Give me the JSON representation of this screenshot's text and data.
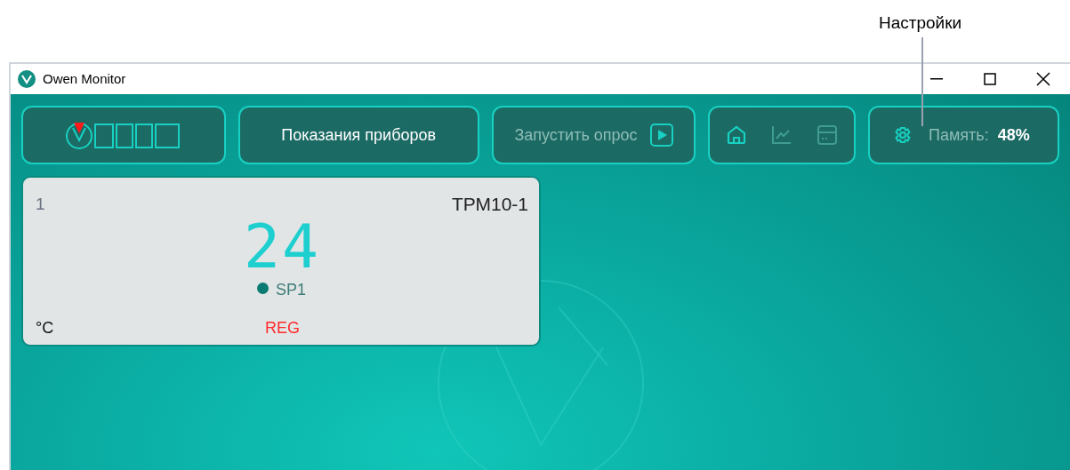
{
  "annotation": {
    "label": "Настройки"
  },
  "window": {
    "title": "Owen Monitor"
  },
  "toolbar": {
    "readings_button": "Показания приборов",
    "start_poll_button": "Запустить опрос",
    "nav": [
      {
        "kind": "home",
        "selected": true
      },
      {
        "kind": "chart",
        "selected": false
      },
      {
        "kind": "panel",
        "selected": false
      }
    ],
    "memory_label": "Память:",
    "memory_value": "48%"
  },
  "devices": [
    {
      "number": "1",
      "model": "ТРМ10-1",
      "value": "24",
      "setpoint": "SP1",
      "unit": "°C",
      "mode": "REG",
      "indicator_on": true
    }
  ]
}
